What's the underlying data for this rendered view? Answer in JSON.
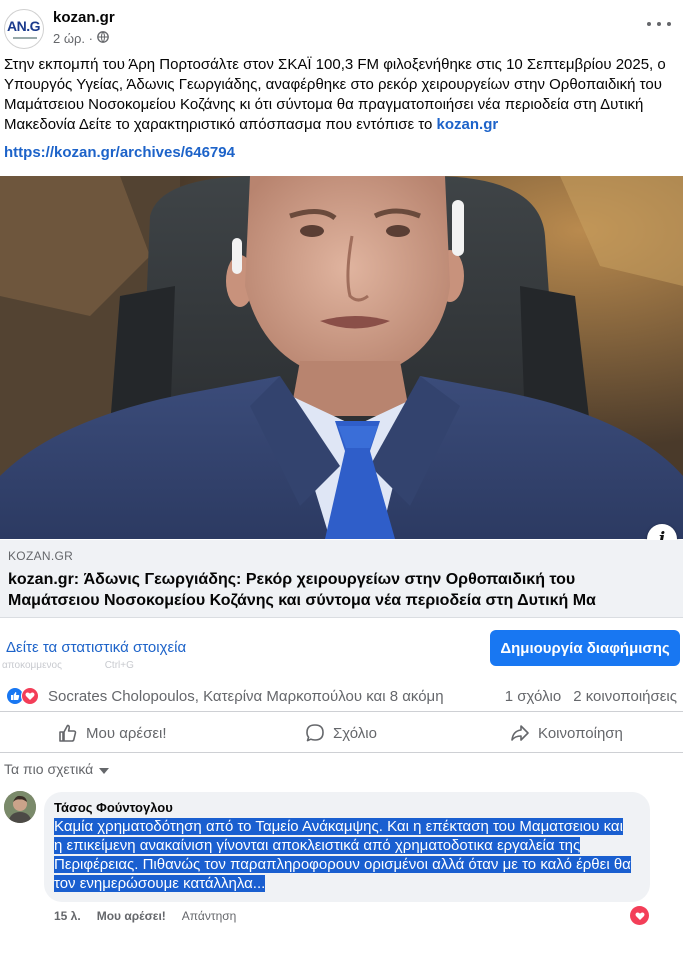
{
  "header": {
    "page_name": "kozan.gr",
    "time": "2 ώρ. ·",
    "logo_text": "AN.G",
    "logo_color": "#1b3a8c"
  },
  "post": {
    "text": "Στην εκπομπή του Άρη Πορτοσάλτε στον ΣΚΑΪ 100,3 FM φιλοξενήθηκε στις 10 Σεπτεμβρίου 2025, ο Υπουργός Υγείας, Άδωνις Γεωργιάδης, αναφέρθηκε στο ρεκόρ χειρουργείων στην Ορθοπαιδική του Μαμάτσειου Νοσοκομείου Κοζάνης κι ότι σύντομα θα πραγματοποιήσει νέα περιοδεία στη Δυτική Μακεδονία Δείτε το χαρακτηριστικό απόσπασμα που εντόπισε το",
    "inline_link": "kozan.gr",
    "url": "https://kozan.gr/archives/646794",
    "link_color": "#1d63c9"
  },
  "link_preview": {
    "domain": "KOZAN.GR",
    "title_line1": "kozan.gr: Άδωνις Γεωργιάδης: Ρεκόρ χειρουργείων στην Ορθοπαιδική του",
    "title_line2": "Μαμάτσειου Νοσοκομείου Κοζάνης και σύντομα νέα περιοδεία στη Δυτική Μα"
  },
  "promo": {
    "stats_link": "Δείτε τα στατιστικά στοιχεία",
    "ghost_left": "αποκομμενος",
    "ghost_right": "Ctrl+G",
    "ad_button": "Δημιουργία διαφήμισης",
    "ad_color": "#1877f2"
  },
  "reactions": {
    "reactors": "Socrates Cholopoulos, Κατερίνα Μαρκοπούλου και 8 ακόμη",
    "comments_count": "1 σχόλιο",
    "shares_count": "2 κοινοποιήσεις"
  },
  "actions": {
    "like": "Μου αρέσει!",
    "comment": "Σχόλιο",
    "share": "Κοινοποίηση"
  },
  "comments": {
    "sort_label": "Τα πιο σχετικά",
    "items": [
      {
        "author": "Τάσος Φούντογλου",
        "text": "Καμία χρηματοδότηση από το Ταμείο Ανάκαμψης. Και η επέκταση του Μαματσειου και η επικείμενη ανακαίνιση γίνονται αποκλειστικά από χρηματοδοτικα εργαλεία της Περιφέρειας. Πιθανώς τον παραπληροφορουν ορισμένοι αλλά όταν με το καλό έρθει θα τον ενημερώσουμε κατάλληλα...",
        "time": "15 λ.",
        "like": "Μου αρέσει!",
        "reply": "Απάντηση"
      }
    ]
  }
}
